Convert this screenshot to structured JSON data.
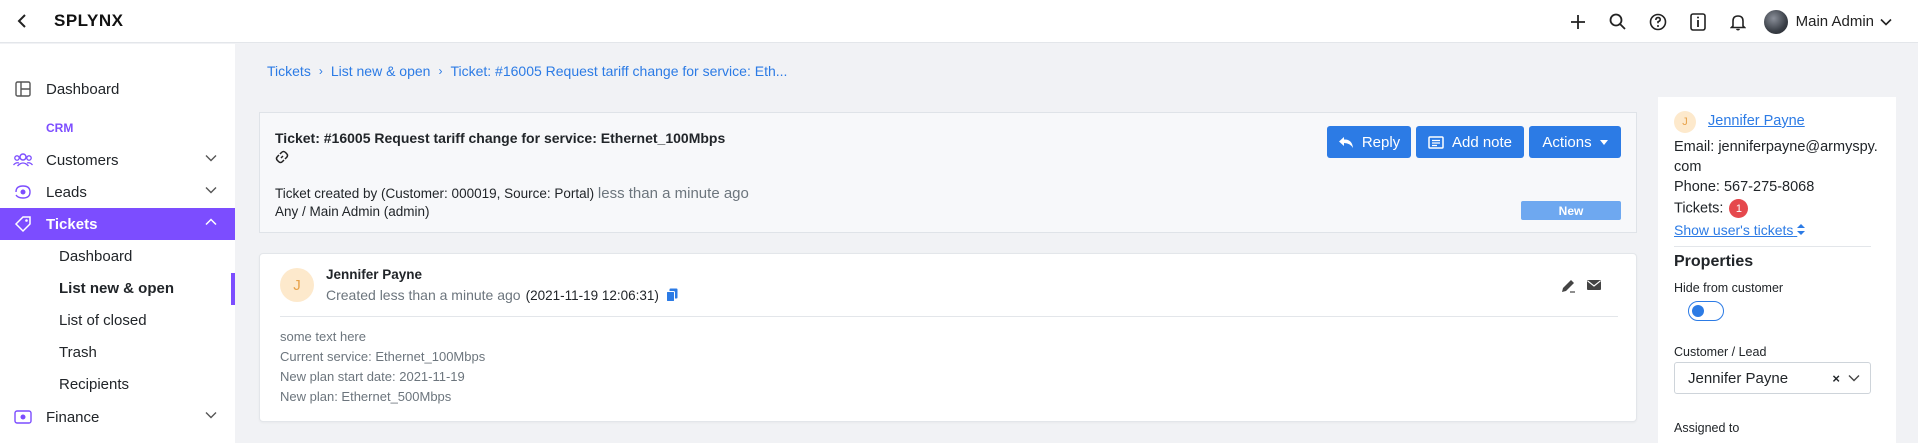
{
  "app": {
    "brand": "SPLYNX",
    "user_name": "Main Admin"
  },
  "sidebar": {
    "section_crm": "CRM",
    "items": [
      {
        "label": "Dashboard"
      },
      {
        "label": "Customers"
      },
      {
        "label": "Leads"
      },
      {
        "label": "Tickets"
      },
      {
        "label": "Finance"
      }
    ],
    "tickets_sub": [
      {
        "label": "Dashboard"
      },
      {
        "label": "List new & open"
      },
      {
        "label": "List of closed"
      },
      {
        "label": "Trash"
      },
      {
        "label": "Recipients"
      }
    ]
  },
  "breadcrumb": {
    "items": [
      "Tickets",
      "List new & open",
      "Ticket: #16005 Request tariff change for service: Eth..."
    ]
  },
  "ticket": {
    "title": "Ticket: #16005 Request tariff change for service: Ethernet_100Mbps",
    "created_by": "Ticket created by (Customer: 000019, Source: Portal)",
    "created_ago": "less than a minute ago",
    "assignment": "Any / Main Admin (admin)",
    "status": "New",
    "buttons": {
      "reply": "Reply",
      "add_note": "Add note",
      "actions": "Actions"
    }
  },
  "message": {
    "avatar_letter": "J",
    "author": "Jennifer Payne",
    "created_ago": "Created less than a minute ago",
    "timestamp": "(2021-11-19 12:06:31)",
    "lines": [
      "some text here",
      "Current service: Ethernet_100Mbps",
      "New plan start date: 2021-11-19",
      "New plan: Ethernet_500Mbps"
    ]
  },
  "customer_panel": {
    "avatar_letter": "J",
    "name": "Jennifer Payne",
    "email": "Email: jenniferpayne@armyspy.com",
    "phone": "Phone: 567-275-8068",
    "tickets_label": "Tickets:",
    "tickets_count": "1",
    "show_tickets": "Show user's tickets",
    "properties_title": "Properties",
    "hide_label": "Hide from customer",
    "hide_from_customer": false,
    "customer_lead_label": "Customer / Lead",
    "customer_lead_value": "Jennifer Payne",
    "clear_glyph": "×",
    "assigned_to_label": "Assigned to"
  },
  "colors": {
    "accent": "#7c4dff",
    "primary": "#2c7be5",
    "status_new": "#6ea8f0",
    "badge_red": "#e5484d"
  },
  "icons": {
    "back": "chevron-left-icon",
    "add": "plus-icon",
    "search": "search-icon",
    "help": "question-circle-icon",
    "info": "info-box-icon",
    "bell": "bell-icon"
  }
}
